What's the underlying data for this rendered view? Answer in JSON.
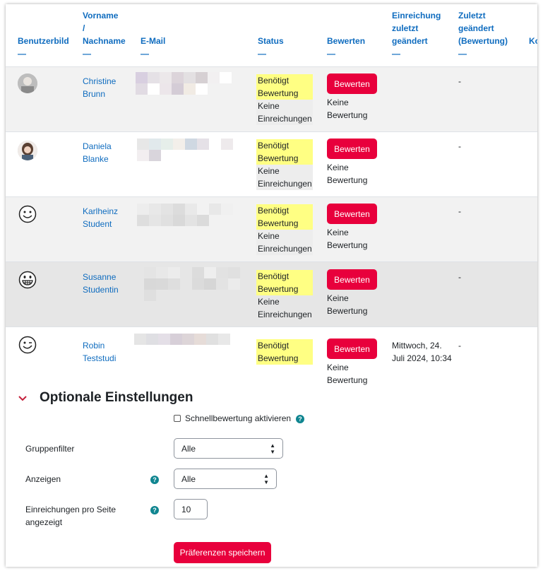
{
  "header": {
    "picture": "Benutzerbild",
    "firstname": "Vorname",
    "slash": "/",
    "lastname": "Nachname",
    "email": "E-Mail",
    "status": "Status",
    "grade": "Bewerten",
    "submission_modified_1": "Einreichung",
    "submission_modified_2": "zuletzt",
    "submission_modified_3": "geändert",
    "grade_modified_1": "Zuletzt",
    "grade_modified_2": "geändert",
    "grade_modified_3": "(Bewertung)",
    "next_col": "Ko",
    "sort_dash": "—"
  },
  "rows": [
    {
      "first": "Christine",
      "last": "Brunn",
      "status_need": "Benötigt Bewertung",
      "status_sub": "Keine Einreichungen",
      "grade_button": "Bewerten",
      "grade_text": "Keine Bewertung",
      "submission_modified": "",
      "grade_modified": "-",
      "avatar": "photo"
    },
    {
      "first": "Daniela",
      "last": "Blanke",
      "status_need": "Benötigt Bewertung",
      "status_sub": "Keine Einreichungen",
      "grade_button": "Bewerten",
      "grade_text": "Keine Bewertung",
      "submission_modified": "",
      "grade_modified": "-",
      "avatar": "photo"
    },
    {
      "first": "Karlheinz",
      "last": "Student",
      "status_need": "Benötigt Bewertung",
      "status_sub": "Keine Einreichungen",
      "grade_button": "Bewerten",
      "grade_text": "Keine Bewertung",
      "submission_modified": "",
      "grade_modified": "-",
      "avatar": "smiley-icon"
    },
    {
      "first": "Susanne",
      "last": "Studentin",
      "status_need": "Benötigt Bewertung",
      "status_sub": "Keine Einreichungen",
      "grade_button": "Bewerten",
      "grade_text": "Keine Bewertung",
      "submission_modified": "",
      "grade_modified": "-",
      "avatar": "grin-icon"
    },
    {
      "first": "Robin",
      "last": "Teststudi",
      "status_need": "Benötigt Bewertung",
      "status_sub": "",
      "grade_button": "Bewerten",
      "grade_text": "Keine Bewertung",
      "submission_modified": "Mittwoch, 24. Juli 2024, 10:34",
      "grade_modified": "-",
      "avatar": "wink-icon"
    }
  ],
  "options": {
    "title": "Optionale Einstellungen",
    "quickgrading": "Schnellbewertung aktivieren",
    "group_filter_label": "Gruppenfilter",
    "group_filter_value": "Alle",
    "show_label": "Anzeigen",
    "show_value": "Alle",
    "per_page_label": "Einreichungen pro Seite angezeigt",
    "per_page_value": "10",
    "save_button": "Präferenzen speichern"
  },
  "colors": {
    "accent": "#e8003c",
    "link": "#0f6cbf",
    "highlight": "#ffff83",
    "help": "#0f8590"
  }
}
